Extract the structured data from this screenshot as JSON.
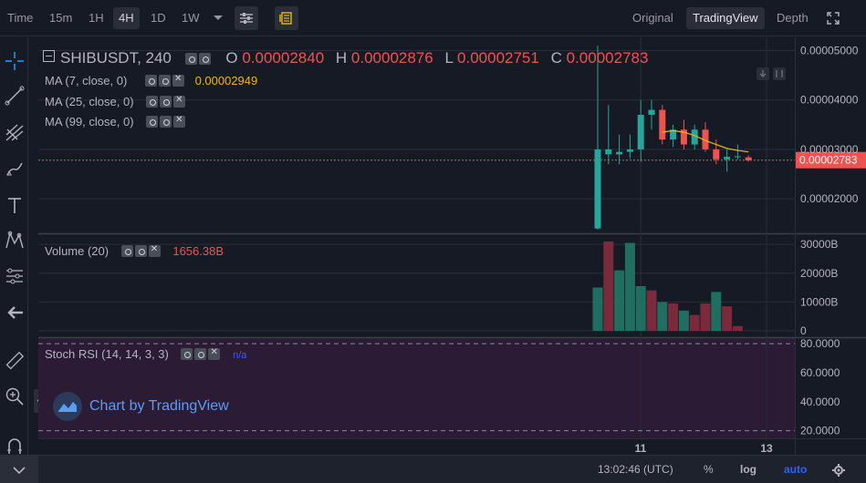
{
  "toolbar": {
    "time_label": "Time",
    "intervals": [
      "15m",
      "1H",
      "4H",
      "1D",
      "1W"
    ],
    "active_interval": "4H",
    "views": [
      "Original",
      "TradingView",
      "Depth"
    ],
    "active_view": "TradingView"
  },
  "legend": {
    "symbol": "SHIBUSDT, 240",
    "o_label": "O",
    "o_value": "0.00002840",
    "h_label": "H",
    "h_value": "0.00002876",
    "l_label": "L",
    "l_value": "0.00002751",
    "c_label": "C",
    "c_value": "0.00002783",
    "ma7_label": "MA (7, close, 0)",
    "ma7_value": "0.00002949",
    "ma25_label": "MA (25, close, 0)",
    "ma99_label": "MA (99, close, 0)",
    "volume_label": "Volume (20)",
    "volume_value": "1656.38B",
    "stoch_label": "Stoch RSI (14, 14, 3, 3)",
    "stoch_value": "n/a"
  },
  "watermark": "Chart by TradingView",
  "statusbar": {
    "time": "13:02:46 (UTC)",
    "percent": "%",
    "log": "log",
    "auto": "auto"
  },
  "colors": {
    "up": "#26a69a",
    "down": "#ef5350",
    "ma7": "#f0b90b",
    "background": "#161a25",
    "grid": "#2a2e39",
    "stoch_bg": "#2b1b35"
  },
  "chart_data": {
    "type": "candlestick",
    "price_axis": {
      "ticks": [
        "0.00005000",
        "0.00004000",
        "0.00003000",
        "0.00002000"
      ],
      "ylim": [
        1.45e-05,
        5.12e-05
      ],
      "last_price": "0.00002783"
    },
    "x_ticks": [
      "11",
      "13"
    ],
    "candles": [
      {
        "o": 1.4e-05,
        "h": 5.1e-05,
        "l": 1.38e-05,
        "c": 3e-05
      },
      {
        "o": 2.9e-05,
        "h": 3.9e-05,
        "l": 2.7e-05,
        "c": 3e-05
      },
      {
        "o": 2.9e-05,
        "h": 3.3e-05,
        "l": 2.7e-05,
        "c": 2.95e-05
      },
      {
        "o": 2.95e-05,
        "h": 3.3e-05,
        "l": 2.82e-05,
        "c": 3e-05
      },
      {
        "o": 3e-05,
        "h": 4e-05,
        "l": 2.75e-05,
        "c": 3.7e-05
      },
      {
        "o": 3.7e-05,
        "h": 4e-05,
        "l": 3.4e-05,
        "c": 3.8e-05
      },
      {
        "o": 3.8e-05,
        "h": 3.9e-05,
        "l": 3.1e-05,
        "c": 3.2e-05
      },
      {
        "o": 3.2e-05,
        "h": 3.5e-05,
        "l": 3.05e-05,
        "c": 3.4e-05
      },
      {
        "o": 3.4e-05,
        "h": 3.6e-05,
        "l": 3e-05,
        "c": 3.1e-05
      },
      {
        "o": 3.1e-05,
        "h": 3.5e-05,
        "l": 3e-05,
        "c": 3.4e-05
      },
      {
        "o": 3.4e-05,
        "h": 3.55e-05,
        "l": 2.95e-05,
        "c": 3e-05
      },
      {
        "o": 3e-05,
        "h": 3.2e-05,
        "l": 2.7e-05,
        "c": 2.8e-05
      },
      {
        "o": 2.8e-05,
        "h": 3e-05,
        "l": 2.55e-05,
        "c": 2.85e-05
      },
      {
        "o": 2.85e-05,
        "h": 3.1e-05,
        "l": 2.8e-05,
        "c": 2.86e-05
      },
      {
        "o": 2.84e-05,
        "h": 2.88e-05,
        "l": 2.75e-05,
        "c": 2.78e-05
      }
    ],
    "ma7": [
      null,
      null,
      null,
      null,
      null,
      null,
      3.35e-05,
      3.38e-05,
      3.35e-05,
      3.28e-05,
      3.18e-05,
      3.1e-05,
      3.02e-05,
      2.98e-05,
      2.95e-05
    ],
    "volume": {
      "label": "Volume (20)",
      "ticks": [
        "30000B",
        "20000B",
        "10000B",
        "0"
      ],
      "ylim": [
        0,
        31000
      ],
      "values": [
        15000,
        31000,
        21000,
        30500,
        15500,
        14000,
        10000,
        9500,
        7000,
        5500,
        9500,
        13500,
        8500,
        1650
      ],
      "directions": [
        "up",
        "down",
        "up",
        "up",
        "up",
        "down",
        "up",
        "down",
        "up",
        "down",
        "down",
        "up",
        "down",
        "down"
      ]
    },
    "stoch_rsi": {
      "label": "Stoch RSI (14, 14, 3, 3)",
      "ticks": [
        "80.0000",
        "60.0000",
        "40.0000",
        "20.0000"
      ],
      "ylim": [
        16,
        82
      ],
      "band": [
        20,
        80
      ]
    }
  }
}
